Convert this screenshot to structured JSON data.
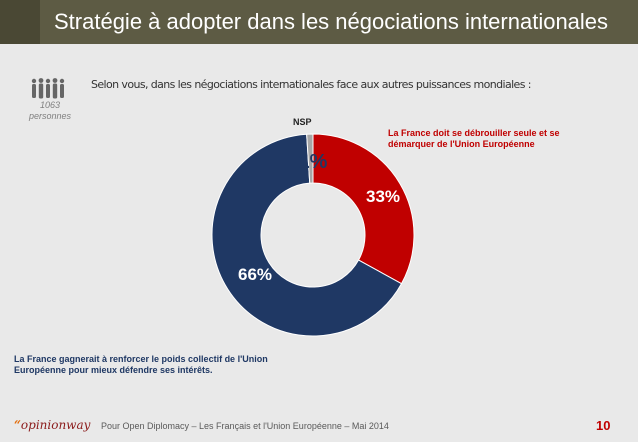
{
  "header": {
    "title": "Stratégie à adopter dans les négociations internationales"
  },
  "question": {
    "text": "Selon vous, dans les négociations internationales face aux autres puissances mondiales :",
    "sample_size": "1063",
    "sample_unit": "personnes",
    "icon": "people-icon"
  },
  "chart_data": {
    "type": "pie",
    "donut": true,
    "slices": [
      {
        "label": "La France doit se débrouiller seule et se démarquer de l'Union Européenne",
        "value": 33,
        "display": "33%",
        "color": "#c00000"
      },
      {
        "label": "La France gagnerait à renforcer le poids collectif de l'Union Européenne pour mieux défendre ses intérêts.",
        "value": 66,
        "display": "66%",
        "color": "#1f3864"
      },
      {
        "label": "NSP",
        "value": 1,
        "display": "1%",
        "color": "#a6a6a6"
      }
    ]
  },
  "footer": {
    "logo_mark": "“",
    "logo_text": "opinionway",
    "text": "Pour Open Diplomacy – Les Français et l'Union Européenne – Mai 2014",
    "page_number": "10"
  },
  "colors": {
    "title_bar": "#5d5b44",
    "accent_red": "#c00000",
    "accent_blue": "#1f3864"
  }
}
